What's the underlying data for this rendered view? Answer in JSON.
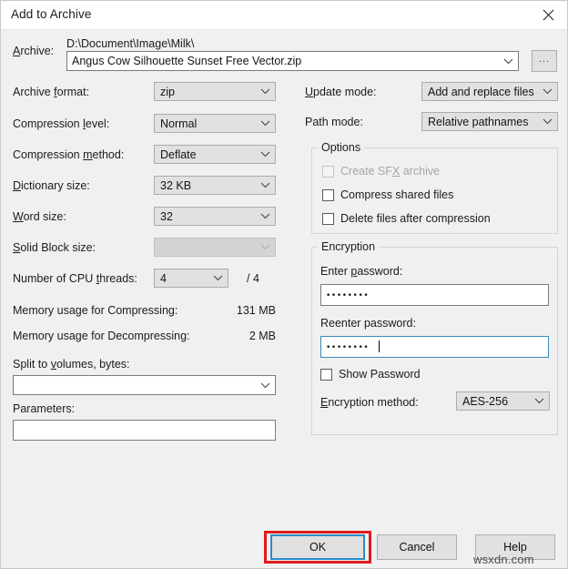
{
  "window": {
    "title": "Add to Archive",
    "close_icon": "close-icon"
  },
  "archive": {
    "label": "Archive:",
    "label_accel": "A",
    "path_text": "D:\\Document\\Image\\Milk\\",
    "value": "Angus Cow Silhouette Sunset Free Vector.zip",
    "browse_label": "..."
  },
  "left_column": {
    "archive_format": {
      "label": "Archive format:",
      "accel": "f",
      "value": "zip"
    },
    "compression_level": {
      "label": "Compression level:",
      "accel": "l",
      "value": "Normal"
    },
    "compression_method": {
      "label": "Compression method:",
      "accel": "m",
      "value": "Deflate"
    },
    "dictionary_size": {
      "label": "Dictionary size:",
      "accel": "D",
      "value": "32 KB"
    },
    "word_size": {
      "label": "Word size:",
      "accel": "W",
      "value": "32"
    },
    "solid_block_size": {
      "label": "Solid Block size:",
      "accel": "S",
      "value": "",
      "disabled": true
    },
    "cpu_threads": {
      "label": "Number of CPU threads:",
      "accel": "t",
      "value": "4",
      "max_text": "/ 4"
    },
    "memory_compressing": {
      "label": "Memory usage for Compressing:",
      "value": "131 MB"
    },
    "memory_decompressing": {
      "label": "Memory usage for Decompressing:",
      "value": "2 MB"
    },
    "split_volumes": {
      "label": "Split to volumes, bytes:",
      "accel": "v",
      "value": ""
    },
    "parameters": {
      "label": "Parameters:",
      "value": ""
    }
  },
  "right_column": {
    "update_mode": {
      "label": "Update mode:",
      "accel": "U",
      "value": "Add and replace files"
    },
    "path_mode": {
      "label": "Path mode:",
      "value": "Relative pathnames"
    },
    "options": {
      "title": "Options",
      "items": [
        {
          "label": "Create SFX archive",
          "accel": "X",
          "checked": false,
          "disabled": true
        },
        {
          "label": "Compress shared files",
          "checked": false,
          "disabled": false
        },
        {
          "label": "Delete files after compression",
          "checked": false,
          "disabled": false
        }
      ]
    },
    "encryption": {
      "title": "Encryption",
      "enter_password_label": "Enter password:",
      "enter_password_accel": "p",
      "enter_password_value": "••••••••",
      "reenter_password_label": "Reenter password:",
      "reenter_password_value": "••••••••",
      "show_password_label": "Show Password",
      "show_password_checked": false,
      "method_label": "Encryption method:",
      "method_accel": "E",
      "method_value": "AES-256"
    }
  },
  "footer": {
    "ok_label": "OK",
    "cancel_label": "Cancel",
    "help_label": "Help",
    "highlight_color": "#e01b1b",
    "focus_color": "#2a8ccc"
  },
  "watermark": {
    "text": "wsxdn.com"
  }
}
